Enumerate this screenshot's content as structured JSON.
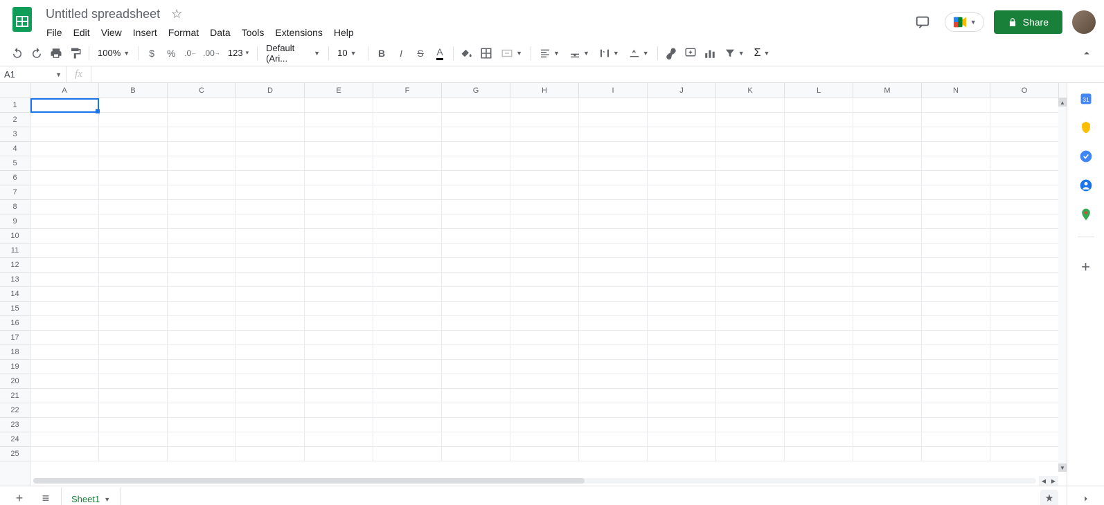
{
  "header": {
    "title": "Untitled spreadsheet",
    "menu": [
      "File",
      "Edit",
      "View",
      "Insert",
      "Format",
      "Data",
      "Tools",
      "Extensions",
      "Help"
    ],
    "share_label": "Share"
  },
  "toolbar": {
    "zoom": "100%",
    "number_fmt": "123",
    "font": "Default (Ari...",
    "font_size": "10"
  },
  "name_box": "A1",
  "formula": "",
  "grid": {
    "columns": [
      "A",
      "B",
      "C",
      "D",
      "E",
      "F",
      "G",
      "H",
      "I",
      "J",
      "K",
      "L",
      "M",
      "N",
      "O"
    ],
    "rows": [
      "1",
      "2",
      "3",
      "4",
      "5",
      "6",
      "7",
      "8",
      "9",
      "10",
      "11",
      "12",
      "13",
      "14",
      "15",
      "16",
      "17",
      "18",
      "19",
      "20",
      "21",
      "22",
      "23",
      "24",
      "25"
    ],
    "active_cell": "A1"
  },
  "tabs": {
    "sheet1": "Sheet1"
  },
  "colors": {
    "brand_green": "#188038",
    "selection_blue": "#1a73e8"
  }
}
